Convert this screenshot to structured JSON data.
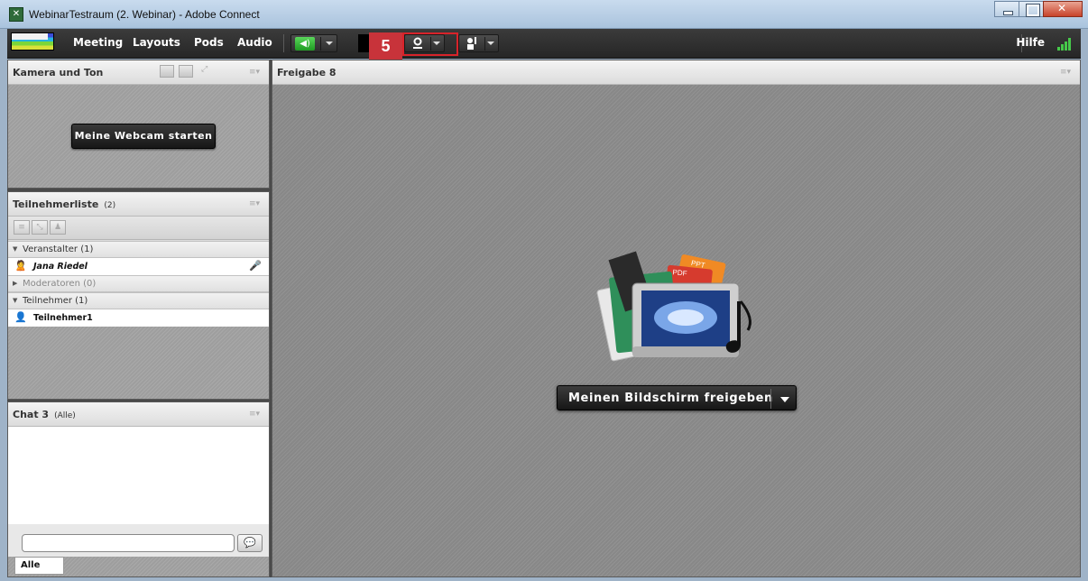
{
  "window": {
    "title": "WebinarTestraum (2. Webinar) - Adobe Connect"
  },
  "menubar": {
    "items": [
      "Meeting",
      "Layouts",
      "Pods",
      "Audio"
    ],
    "help": "Hilfe",
    "callout_number": "5"
  },
  "camera_pod": {
    "title": "Kamera und Ton",
    "start_button": "Meine Webcam starten"
  },
  "attendees_pod": {
    "title": "Teilnehmerliste",
    "count": "(2)",
    "groups": [
      {
        "label": "Veranstalter (1)",
        "expanded": true,
        "members": [
          "Jana Riedel"
        ]
      },
      {
        "label": "Moderatoren (0)",
        "expanded": false,
        "members": []
      },
      {
        "label": "Teilnehmer (1)",
        "expanded": true,
        "members": [
          "Teilnehmer1"
        ]
      }
    ]
  },
  "chat_pod": {
    "title": "Chat 3",
    "scope": "(Alle)",
    "input_value": "",
    "tab": "Alle"
  },
  "share_pod": {
    "title": "Freigabe 8",
    "share_button": "Meinen Bildschirm freigeben",
    "doc_labels": [
      "PPT",
      "PDF"
    ]
  },
  "colors": {
    "accent_red": "#c8333a",
    "toolbar_bg": "#2c2c2c",
    "speaker_green": "#3bb93d"
  },
  "icons": [
    "app-icon",
    "minimize-icon",
    "maximize-icon",
    "close-icon",
    "speaker-icon",
    "webcam-icon",
    "raise-hand-icon",
    "signal-icon",
    "pod-menu-icon",
    "host-icon",
    "microphone-icon",
    "participant-icon",
    "send-icon",
    "dropdown-icon"
  ]
}
